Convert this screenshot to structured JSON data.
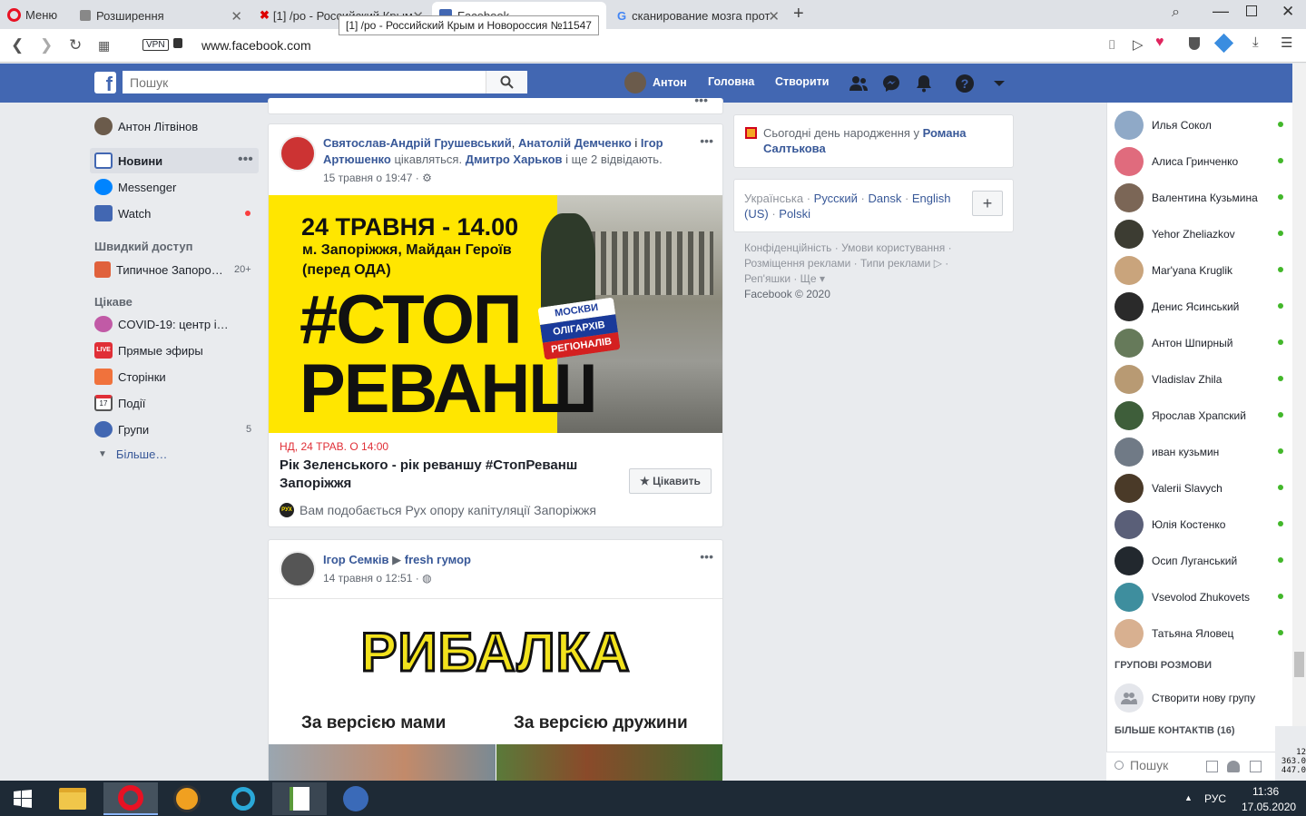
{
  "browser": {
    "menu_label": "Меню",
    "tabs": [
      {
        "label": "Розширення"
      },
      {
        "label": "[1] /ро - Российский Крым"
      },
      {
        "label": "Facebook"
      },
      {
        "label": "сканирование мозга прот"
      }
    ],
    "tooltip": "[1] /ро - Российский Крым и Новороссия №11547",
    "vpn": "VPN",
    "url": "www.facebook.com"
  },
  "fb": {
    "logo": "f",
    "search_placeholder": "Пошук",
    "user": "Антон",
    "home": "Головна",
    "create": "Створити"
  },
  "left": {
    "profile": "Антон Літвінов",
    "news": "Новини",
    "messenger": "Messenger",
    "watch": "Watch",
    "quick_head": "Швидкий доступ",
    "quick_item": "Типичное Запоро…",
    "quick_count": "20+",
    "interest_head": "Цікаве",
    "items": [
      {
        "label": "COVID-19: центр і…",
        "count": ""
      },
      {
        "label": "Прямые эфиры",
        "count": ""
      },
      {
        "label": "Сторінки",
        "count": ""
      },
      {
        "label": "Події",
        "count": ""
      },
      {
        "label": "Групи",
        "count": "5"
      }
    ],
    "more": "Більше…",
    "live_badge": "LIVE",
    "calendar_day": "17"
  },
  "post1": {
    "names_a": "Святослав-Андрій Грушевський",
    "comma": ", ",
    "names_b": "Анатолій Демченко",
    "and": " і ",
    "names_c": "Ігор Артюшенко",
    "interested": " цікавляться. ",
    "name_d": "Дмитро Харьков",
    "and_more": " і ще 2 відвідають.",
    "time": "15 травня о 19:47 · ",
    "img_line1": "24 ТРАВНЯ - 14.00",
    "img_line2": "м. Запоріжжя, Майдан Героїв",
    "img_line3": "(перед ОДА)",
    "img_big1": "#СТОП",
    "img_big2": "РЕВАНШ",
    "flag1": "МОСКВИ",
    "flag2": "ОЛІГАРХІВ",
    "flag3": "РЕГІОНАЛІВ",
    "event_date": "НД, 24 ТРАВ. О 14:00",
    "event_title": "Рік Зеленського - рік реваншу #СтопРеванш Запоріжжя",
    "interested_btn": "★ Цікавить",
    "liked": "Вам подобається Рух опору капітуляції Запоріжжя",
    "liked_badge": "РУХ"
  },
  "post2": {
    "author": "Ігор Семків",
    "arrow": " ▶ ",
    "group": "fresh гумор",
    "time": "14 травня о 12:51 · ",
    "img_title": "РИБАЛКА",
    "img_left": "За версією мами",
    "img_right": "За версією дружини"
  },
  "rightcol": {
    "birthday": "Сьогодні день народження у ",
    "birthday_name": "Романа Салтькова",
    "langs": [
      "Українська",
      "Русский",
      "Dansk",
      "English (US)",
      "Polski"
    ],
    "footer_lines": [
      "Конфіденційність · Умови користування ·",
      "Розміщення реклами · Типи реклами ▷ ·",
      "Реп'яшки · Ще ▾",
      "Facebook © 2020"
    ]
  },
  "chat": {
    "contacts": [
      {
        "name": "Илья Сокол",
        "color": "#8fa9c7"
      },
      {
        "name": "Алиса Гринченко",
        "color": "#e06b7d"
      },
      {
        "name": "Валентина Кузьмина",
        "color": "#7b6656"
      },
      {
        "name": "Yehor Zheliazkov",
        "color": "#3c3c32"
      },
      {
        "name": "Mar'yana Kruglik",
        "color": "#c9a47c"
      },
      {
        "name": "Денис Ясинський",
        "color": "#2a2a2a"
      },
      {
        "name": "Антон Шпирный",
        "color": "#667a5a"
      },
      {
        "name": "Vladislav Zhila",
        "color": "#b89a73"
      },
      {
        "name": "Ярослав Храпский",
        "color": "#3e5e3a"
      },
      {
        "name": "иван кузьмин",
        "color": "#707a86"
      },
      {
        "name": "Valerii Slavych",
        "color": "#4a3a28"
      },
      {
        "name": "Юлія Костенко",
        "color": "#5a5f78"
      },
      {
        "name": "Осип Луганський",
        "color": "#22282e"
      },
      {
        "name": "Vsevolod Zhukovets",
        "color": "#3e8e9e"
      },
      {
        "name": "Татьяна Яловец",
        "color": "#d8b090"
      }
    ],
    "groups_head": "ГРУПОВІ РОЗМОВИ",
    "new_group": "Створити нову групу",
    "more_contacts": "БІЛЬШЕ КОНТАКТІВ (16)",
    "search_placeholder": "Пошук"
  },
  "taskbar": {
    "lang": "РУС",
    "time": "11:36",
    "date": "17.05.2020",
    "tray_caret": "▲",
    "meter": [
      "12",
      "363.0",
      "447.0"
    ]
  },
  "colors": {
    "fb_blue": "#4267b2",
    "link": "#385898",
    "online": "#42b72a"
  }
}
